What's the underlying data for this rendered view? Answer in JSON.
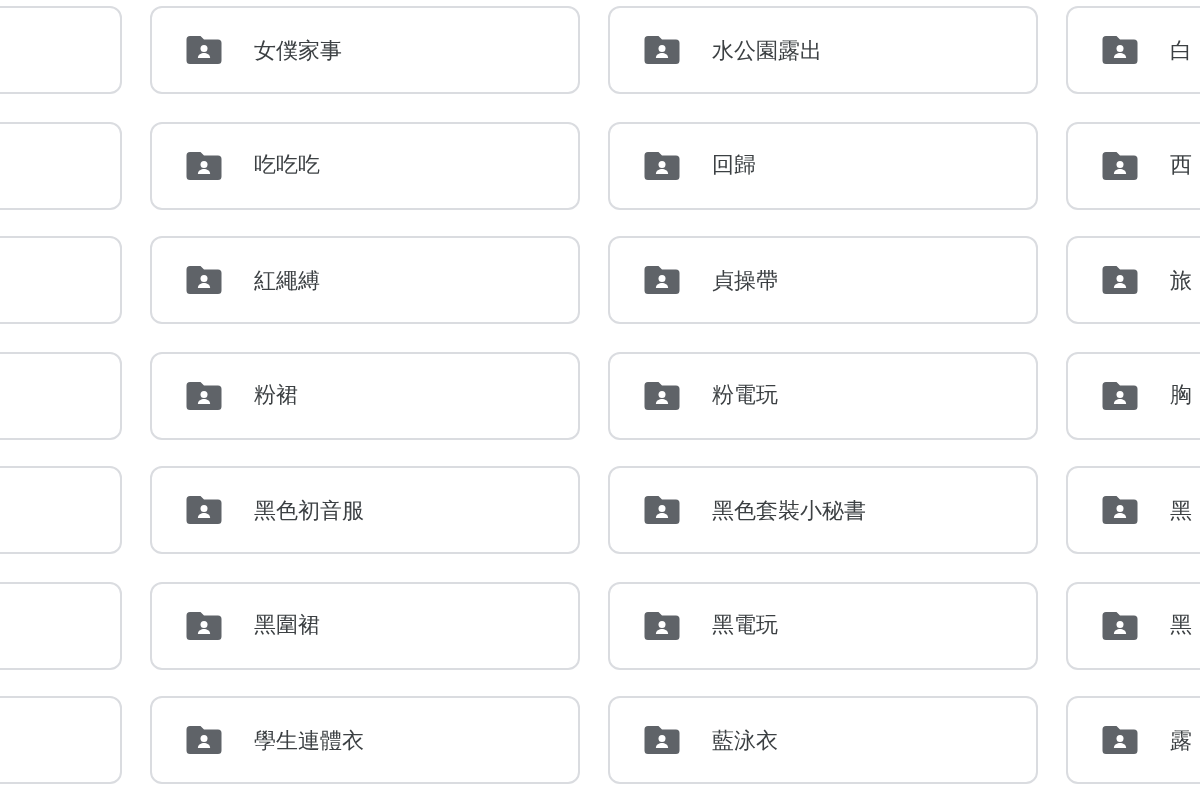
{
  "folder_rows": [
    {
      "folders": [
        {
          "name": "女僕家事"
        },
        {
          "name": "水公園露出"
        },
        {
          "name": "白"
        }
      ]
    },
    {
      "folders": [
        {
          "name": "吃吃吃"
        },
        {
          "name": "回歸"
        },
        {
          "name": "西"
        }
      ]
    },
    {
      "folders": [
        {
          "name": "紅繩縛"
        },
        {
          "name": "貞操帶"
        },
        {
          "name": "旅"
        }
      ]
    },
    {
      "folders": [
        {
          "name": "粉裙"
        },
        {
          "name": "粉電玩"
        },
        {
          "name": "胸"
        }
      ]
    },
    {
      "folders": [
        {
          "name": "黑色初音服"
        },
        {
          "name": "黑色套裝小秘書"
        },
        {
          "name": "黑"
        }
      ]
    },
    {
      "folders": [
        {
          "name": "黑圍裙"
        },
        {
          "name": "黑電玩"
        },
        {
          "name": "黑"
        }
      ]
    },
    {
      "folders": [
        {
          "name": "學生連體衣"
        },
        {
          "name": "藍泳衣"
        },
        {
          "name": "露"
        }
      ]
    }
  ]
}
